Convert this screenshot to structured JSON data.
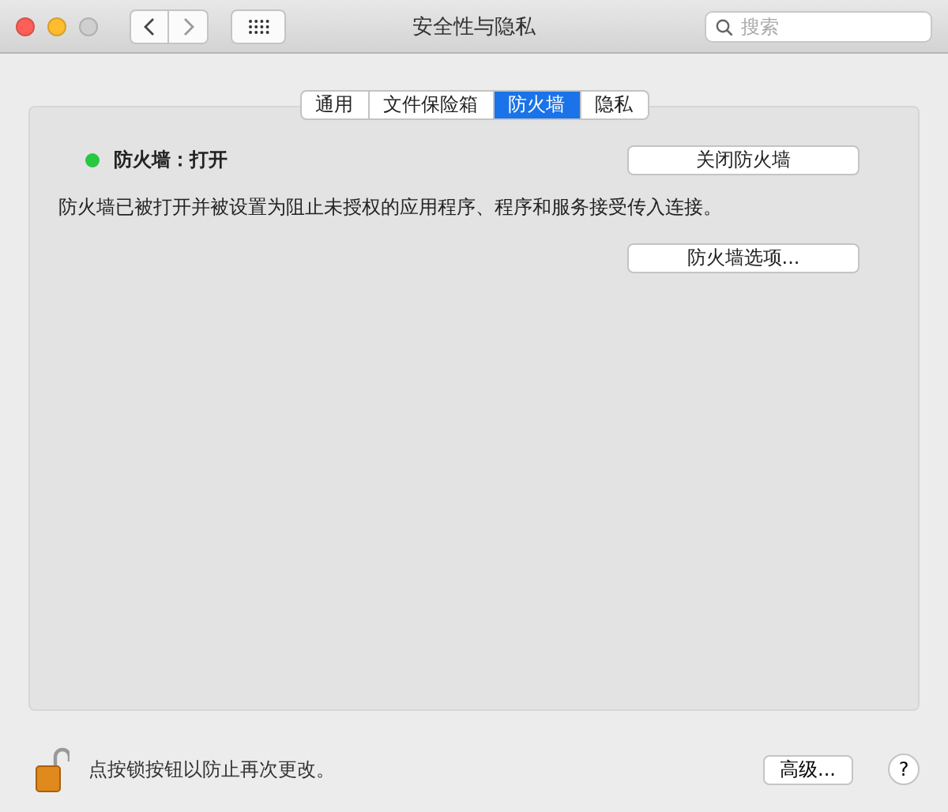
{
  "window": {
    "title": "安全性与隐私"
  },
  "search": {
    "placeholder": "搜索"
  },
  "tabs": [
    {
      "label": "通用",
      "selected": false
    },
    {
      "label": "文件保险箱",
      "selected": false
    },
    {
      "label": "防火墙",
      "selected": true
    },
    {
      "label": "隐私",
      "selected": false
    }
  ],
  "firewall": {
    "status": "防火墙：打开",
    "on": true,
    "toggle_button": "关闭防火墙",
    "description": "防火墙已被打开并被设置为阻止未授权的应用程序、程序和服务接受传入连接。",
    "options_button": "防火墙选项..."
  },
  "footer": {
    "lock_text": "点按锁按钮以防止再次更改。",
    "locked": false,
    "advanced_button": "高级...",
    "help_button": "?"
  }
}
